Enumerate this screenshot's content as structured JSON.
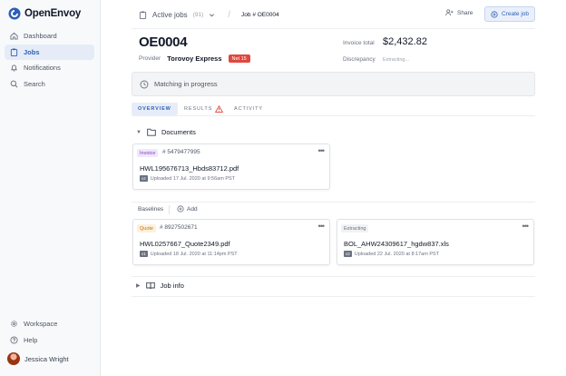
{
  "app": {
    "name": "OpenEnvoy"
  },
  "sidebar": {
    "items": [
      {
        "label": "Dashboard",
        "icon": "home-icon"
      },
      {
        "label": "Jobs",
        "icon": "clipboard-icon",
        "active": true
      },
      {
        "label": "Notifications",
        "icon": "bell-icon"
      },
      {
        "label": "Search",
        "icon": "search-icon"
      }
    ],
    "bottom_items": [
      {
        "label": "Workspace",
        "icon": "gear-icon"
      },
      {
        "label": "Help",
        "icon": "help-icon"
      }
    ],
    "user": {
      "name": "Jessica Wright"
    }
  },
  "topbar": {
    "section": "Active jobs",
    "count": "(91)",
    "separator": "/",
    "job": "Job # OE0004",
    "share_label": "Share",
    "create_label": "Create job"
  },
  "job": {
    "id": "OE0004",
    "provider_label": "Provider",
    "provider_name": "Torovoy Express",
    "terms": "Net 15",
    "total_label": "Invoice total",
    "total": "$2,432.82",
    "discrepancy_label": "Discrepancy",
    "discrepancy_value": "Extracting..."
  },
  "status": {
    "text": "Matching in progress"
  },
  "tabs": [
    {
      "label": "OVERVIEW",
      "active": true
    },
    {
      "label": "RESULTS",
      "warning": true
    },
    {
      "label": "ACTIVITY"
    }
  ],
  "documents": {
    "title": "Documents",
    "invoice": {
      "tag": "Invoice",
      "number": "# 5479477995",
      "filename": "HWL195676713_Hbds83712.pdf",
      "version": "v2",
      "uploaded": "Uploaded 17 Jul. 2020 at 9:56am PST"
    }
  },
  "baselines": {
    "label": "Baselines",
    "add_label": "Add",
    "cards": [
      {
        "tag": "Quote",
        "number": "# 8927502671",
        "filename": "HWL0257667_Quote2349.pdf",
        "version": "v1",
        "uploaded": "Uploaded 18 Jul. 2020 at 11:14pm PST"
      },
      {
        "tag": "Extracting",
        "filename": "BOL_AHW24309617_hgdw837.xls",
        "version": "v2",
        "uploaded": "Uploaded 22 Jul. 2020 at 8:17am PST"
      }
    ]
  },
  "job_info": {
    "title": "Job info"
  },
  "colors": {
    "accent": "#2f5fb5",
    "danger": "#e0483f",
    "invoice_tag": "#7e3fc4",
    "quote_tag": "#b9761b"
  }
}
